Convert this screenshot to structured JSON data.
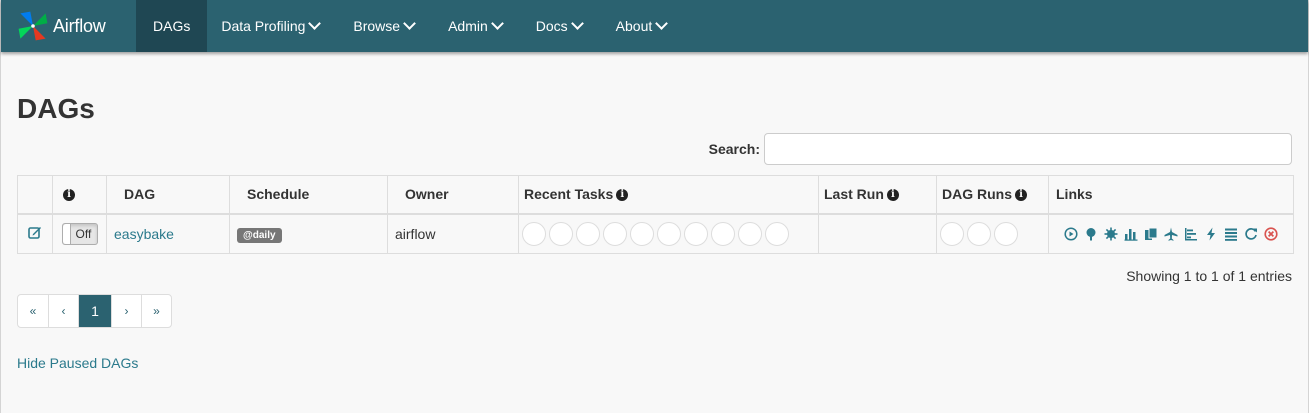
{
  "navbar": {
    "brand": "Airflow",
    "items": [
      {
        "label": "DAGs"
      },
      {
        "label": "Data Profiling"
      },
      {
        "label": "Browse"
      },
      {
        "label": "Admin"
      },
      {
        "label": "Docs"
      },
      {
        "label": "About"
      }
    ]
  },
  "page": {
    "title": "DAGs",
    "search_label": "Search:",
    "search_value": "",
    "info_text": "Showing 1 to 1 of 1 entries",
    "hide_paused": "Hide Paused DAGs"
  },
  "table": {
    "headers": {
      "dag": "DAG",
      "schedule": "Schedule",
      "owner": "Owner",
      "recent_tasks": "Recent Tasks",
      "last_run": "Last Run",
      "dag_runs": "DAG Runs",
      "links": "Links"
    },
    "rows": [
      {
        "toggle": "Off",
        "dag": "easybake",
        "schedule": "@daily",
        "owner": "airflow",
        "last_run": ""
      }
    ]
  },
  "pagination": {
    "first": "«",
    "prev": "‹",
    "current": "1",
    "next": "›",
    "last": "»"
  },
  "colors": {
    "navbar": "#2b6270",
    "navbar_active": "#1f4753",
    "link": "#2b7a8c",
    "delete": "#d9534f"
  },
  "icons": {
    "links": [
      "trigger-dag-icon",
      "tree-view-icon",
      "graph-view-icon",
      "task-duration-icon",
      "task-tries-icon",
      "landing-times-icon",
      "gantt-icon",
      "code-icon",
      "logs-icon",
      "refresh-icon",
      "delete-icon"
    ]
  }
}
